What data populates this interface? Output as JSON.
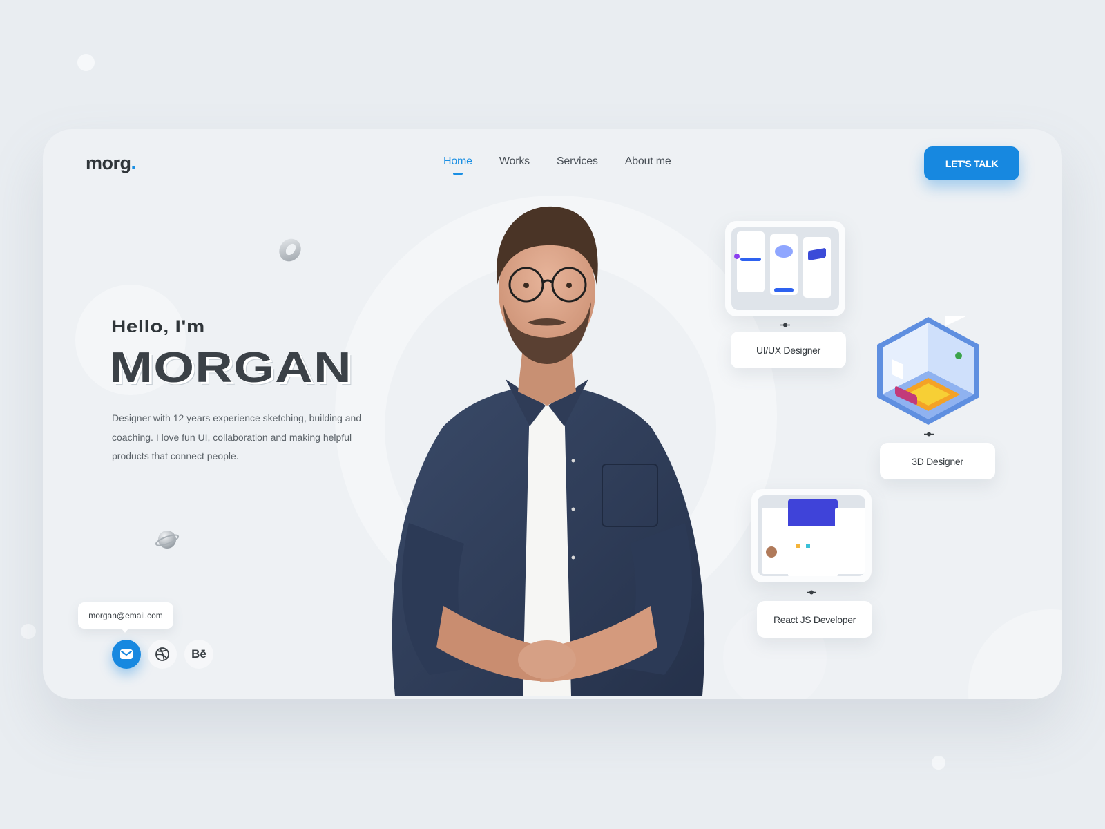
{
  "logo": {
    "text": "morg",
    "dot": "."
  },
  "nav": {
    "items": [
      {
        "label": "Home",
        "active": true
      },
      {
        "label": "Works",
        "active": false
      },
      {
        "label": "Services",
        "active": false
      },
      {
        "label": "About me",
        "active": false
      }
    ]
  },
  "cta": {
    "label": "LET'S TALK"
  },
  "hero": {
    "greeting": "Hello, I'm",
    "name": "MORGAN",
    "description": "Designer with 12 years experience sketching, building and coaching. I love fun UI, collaboration and making helpful products that connect people."
  },
  "contact": {
    "email": "morgan@email.com",
    "socials": [
      {
        "name": "mail",
        "icon": "mail-icon"
      },
      {
        "name": "dribbble",
        "icon": "dribbble-icon"
      },
      {
        "name": "behance",
        "icon": "behance-icon",
        "text": "Bē"
      }
    ]
  },
  "roles": [
    {
      "label": "UI/UX Designer",
      "preview": "mobile-app-preview"
    },
    {
      "label": "3D Designer",
      "preview": "isometric-room-illustration"
    },
    {
      "label": "React JS Developer",
      "preview": "website-preview"
    }
  ],
  "colors": {
    "accent": "#1788e0",
    "text": "#2f3539",
    "background": "#e9edf1"
  }
}
